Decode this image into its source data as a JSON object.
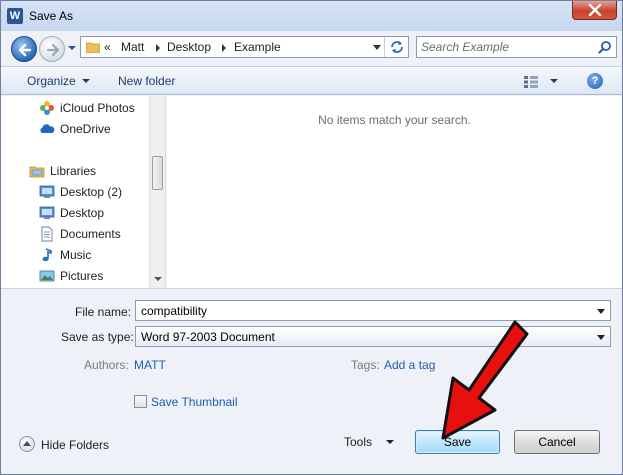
{
  "window": {
    "title": "Save As",
    "app_icon": "word-doc-icon",
    "close_icon": "close-icon"
  },
  "address_bar": {
    "overflow": "«",
    "crumbs": [
      "Matt",
      "Desktop",
      "Example"
    ]
  },
  "search": {
    "placeholder": "Search Example"
  },
  "toolbar": {
    "organize_label": "Organize",
    "new_folder_label": "New folder",
    "help_label": "?"
  },
  "nav_pane": {
    "favorites_tail": [
      {
        "label": "iCloud Photos",
        "icon": "icloud-photos-icon"
      },
      {
        "label": "OneDrive",
        "icon": "onedrive-icon"
      }
    ],
    "libraries": {
      "label": "Libraries",
      "icon": "libraries-icon",
      "items": [
        {
          "label": "Desktop (2)",
          "icon": "desktop-folder-icon"
        },
        {
          "label": "Desktop",
          "icon": "desktop-folder-icon"
        },
        {
          "label": "Documents",
          "icon": "documents-icon"
        },
        {
          "label": "Music",
          "icon": "music-icon"
        },
        {
          "label": "Pictures",
          "icon": "pictures-icon"
        }
      ]
    }
  },
  "content": {
    "empty_message": "No items match your search."
  },
  "form": {
    "file_name_label": "File name:",
    "file_name_value": "compatibility",
    "save_as_type_label": "Save as type:",
    "save_as_type_value": "Word 97-2003 Document",
    "authors_label": "Authors:",
    "authors_value": "MATT",
    "tags_label": "Tags:",
    "tags_value": "Add a tag",
    "save_thumbnail_label": "Save Thumbnail",
    "save_thumbnail_checked": false
  },
  "footer": {
    "hide_folders_label": "Hide Folders",
    "tools_label": "Tools",
    "save_label": "Save",
    "cancel_label": "Cancel"
  },
  "colors": {
    "arrow": "#e8100f",
    "link": "#1f5dad",
    "close_button": "#c7422e"
  }
}
